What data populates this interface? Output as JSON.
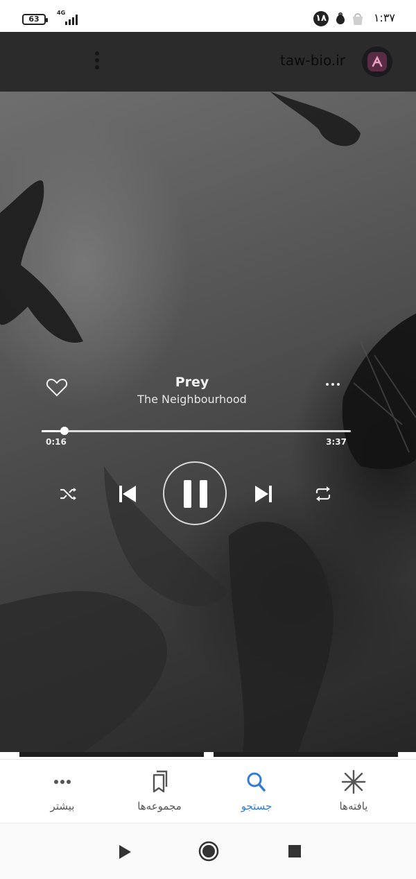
{
  "status_bar": {
    "battery": "63",
    "network": "4G",
    "notification_count": "۱۸",
    "time": "۱:۳۷"
  },
  "browser": {
    "url": "taw-bio.ir"
  },
  "player": {
    "title": "Prey",
    "artist": "The Neighbourhood",
    "elapsed": "0:16",
    "total": "3:37",
    "progress_fraction": 0.074,
    "is_playing": true
  },
  "bottom_nav": {
    "items": [
      {
        "label": "بیشتر",
        "icon": "more-dots-icon",
        "active": false
      },
      {
        "label": "مجموعه‌ها",
        "icon": "bookmarks-icon",
        "active": false
      },
      {
        "label": "جستجو",
        "icon": "search-icon",
        "active": true
      },
      {
        "label": "یافته‌ها",
        "icon": "discover-asterisk-icon",
        "active": false
      }
    ]
  },
  "colors": {
    "accent": "#2f7cd4",
    "toolbar": "#2b2b2b"
  }
}
